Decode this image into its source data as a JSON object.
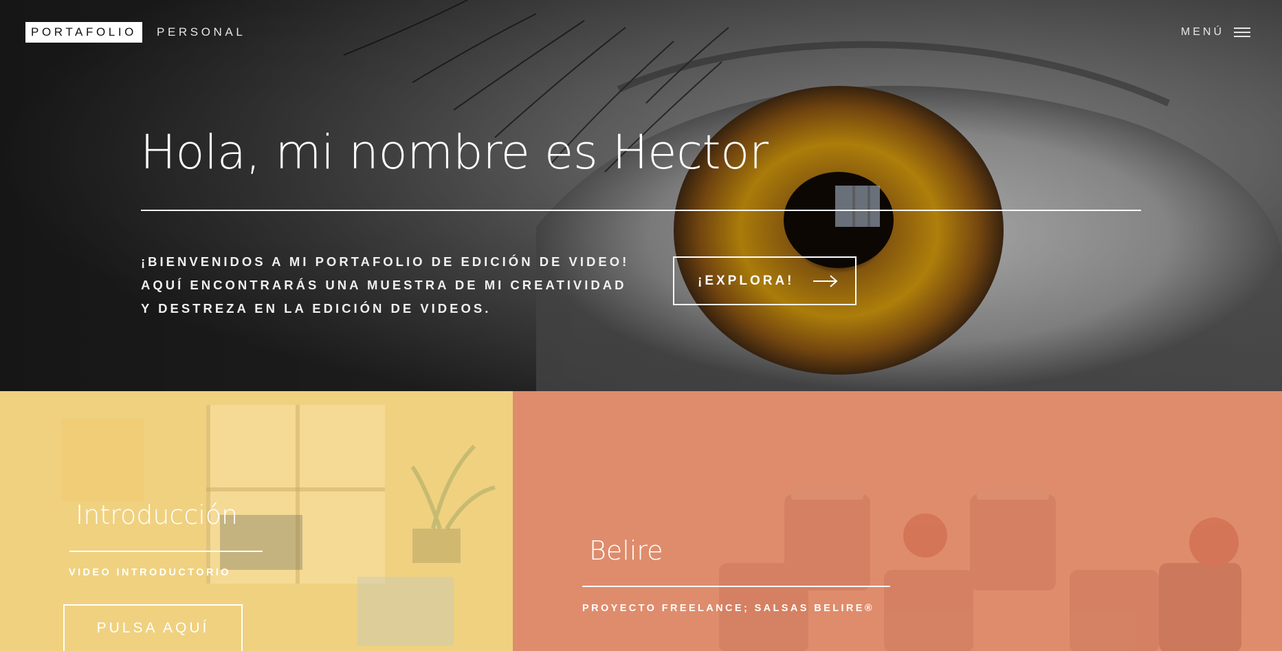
{
  "header": {
    "logo_main": "PORTAFOLIO",
    "logo_sub": "PERSONAL",
    "menu_label": "MENÚ",
    "menu_icon": "hamburger-icon"
  },
  "hero": {
    "title": "Hola, mi nombre es Hector",
    "intro_lines": [
      "¡BIENVENIDOS A MI PORTAFOLIO DE EDICIÓN DE VIDEO!",
      "AQUÍ ENCONTRARÁS UNA MUESTRA DE MI CREATIVIDAD",
      "Y DESTREZA EN LA EDICIÓN DE VIDEOS."
    ],
    "cta_label": "¡EXPLORA!",
    "cta_icon": "arrow-right-icon"
  },
  "projects": [
    {
      "title": "Introducción",
      "subtitle": "VIDEO INTRODUCTORIO",
      "button_label": "PULSA AQUÍ",
      "overlay_color": "#efd180"
    },
    {
      "title": "Belire",
      "subtitle": "PROYECTO FREELANCE; SALSAS BELIRE®",
      "overlay_color": "#df8c6c"
    }
  ],
  "colors": {
    "text": "#ffffff",
    "logo_bg": "#ffffff",
    "logo_text": "#111111"
  }
}
